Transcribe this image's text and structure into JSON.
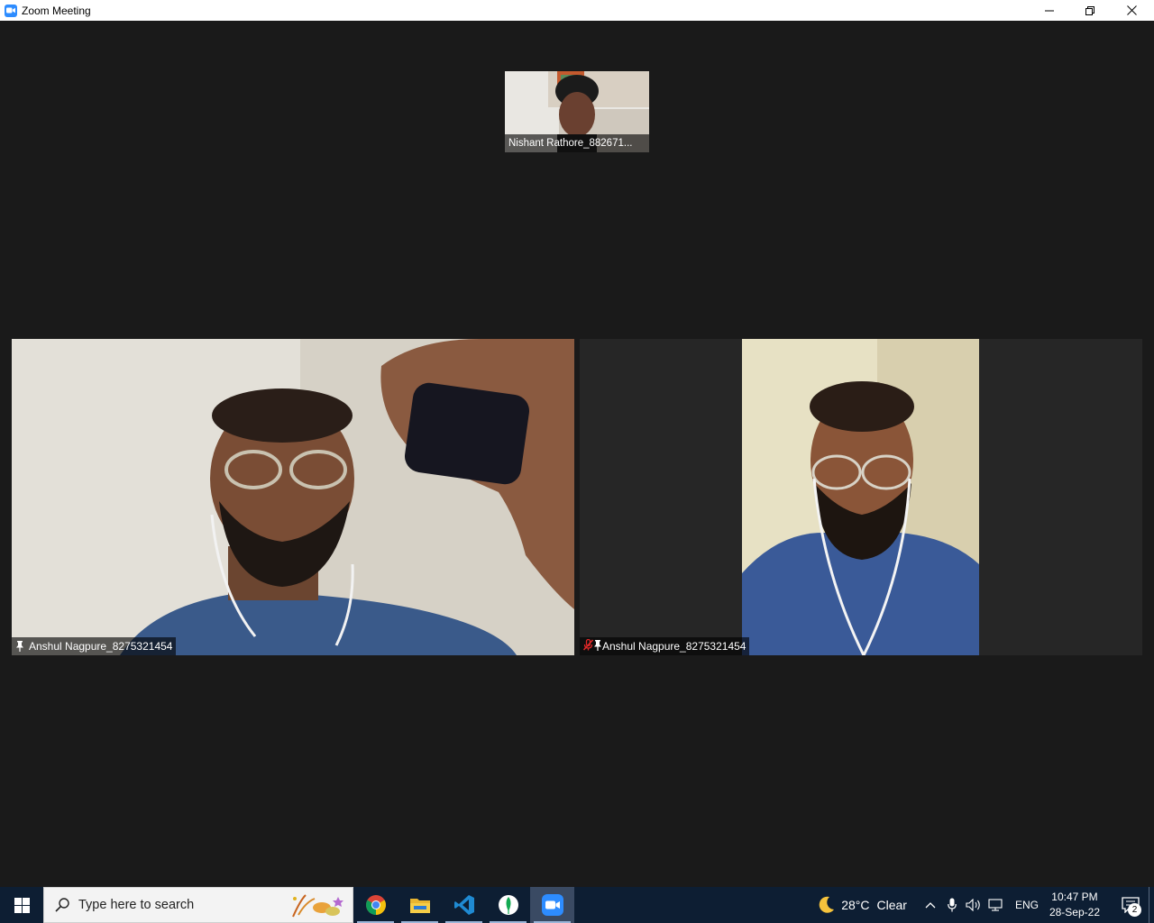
{
  "window": {
    "title": "Zoom Meeting",
    "controls": {
      "minimize": "minimize-icon",
      "restore": "restore-icon",
      "close": "close-icon"
    }
  },
  "meeting": {
    "participants": [
      {
        "name": "Nishant Rathore_882671...",
        "tile": "thumbnail",
        "pinned": false,
        "muted": false
      },
      {
        "name": "Anshul Nagpure_8275321454",
        "tile": "main-left",
        "pinned": true,
        "muted": false
      },
      {
        "name": "Anshul Nagpure_8275321454",
        "tile": "main-right",
        "pinned": true,
        "muted": true
      }
    ]
  },
  "taskbar": {
    "search_placeholder": "Type here to search",
    "apps": [
      {
        "name": "Google Chrome",
        "icon": "chrome-icon",
        "active": false
      },
      {
        "name": "File Explorer",
        "icon": "folder-icon",
        "active": false
      },
      {
        "name": "Visual Studio Code",
        "icon": "vscode-icon",
        "active": false
      },
      {
        "name": "MongoDB Compass",
        "icon": "mongodb-icon",
        "active": false
      },
      {
        "name": "Zoom",
        "icon": "zoom-icon",
        "active": true
      }
    ],
    "weather": {
      "temp": "28°C",
      "condition": "Clear",
      "icon": "moon-icon"
    },
    "language": "ENG",
    "time": "10:47 PM",
    "date": "28-Sep-22",
    "notifications": "2"
  },
  "colors": {
    "zoom_blue": "#2d8cff",
    "meeting_bg": "#1a1a1a",
    "taskbar": "#0d1e33"
  }
}
